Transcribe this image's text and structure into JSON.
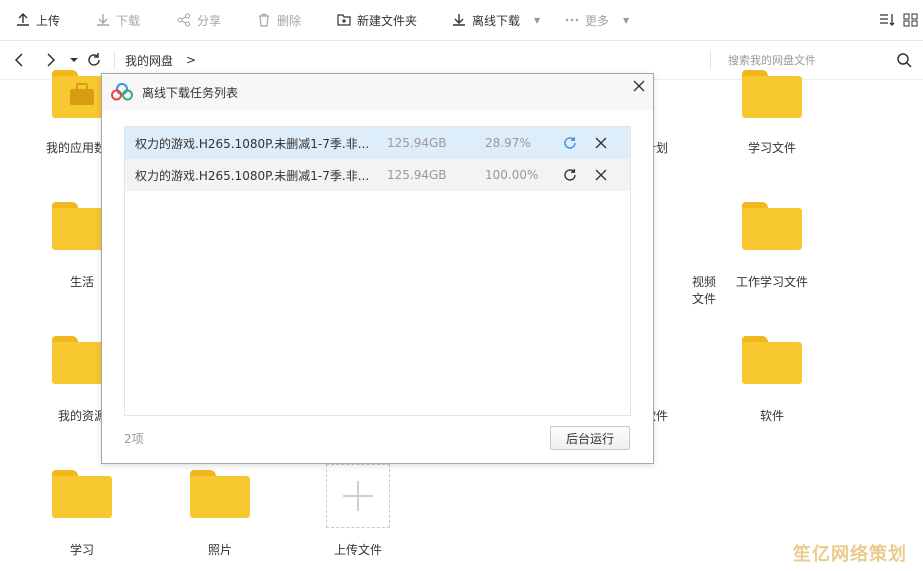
{
  "toolbar": {
    "upload": "上传",
    "download": "下载",
    "share": "分享",
    "delete": "删除",
    "new_folder": "新建文件夹",
    "offline_download": "离线下载",
    "more": "更多"
  },
  "address": {
    "crumb": "我的网盘",
    "crumb_sep": ">",
    "search_placeholder": "搜索我的网盘文件"
  },
  "grid": {
    "items": [
      {
        "label": "我的应用数据"
      },
      {
        "label": "计划"
      },
      {
        "label": "学习文件"
      },
      {
        "label": "生活"
      },
      {
        "label": "视频文件"
      },
      {
        "label": "工作学习文件"
      },
      {
        "label": "我的资源"
      },
      {
        "label": "软件"
      },
      {
        "label": "软件"
      },
      {
        "label": "学习"
      },
      {
        "label": "照片"
      },
      {
        "label": "上传文件"
      }
    ]
  },
  "dialog": {
    "title": "离线下载任务列表",
    "tasks": [
      {
        "name": "权力的游戏.H265.1080P.未删减1-7季.非...",
        "size": "125.94GB",
        "progress": "28.97%"
      },
      {
        "name": "权力的游戏.H265.1080P.未删减1-7季.非...",
        "size": "125.94GB",
        "progress": "100.00%"
      }
    ],
    "count": "2项",
    "background_button": "后台运行"
  },
  "colors": {
    "folder": "#f8c830",
    "selected_row": "#deedfa",
    "accent": "#3b8fd9"
  },
  "watermark": "笙亿网络策划"
}
